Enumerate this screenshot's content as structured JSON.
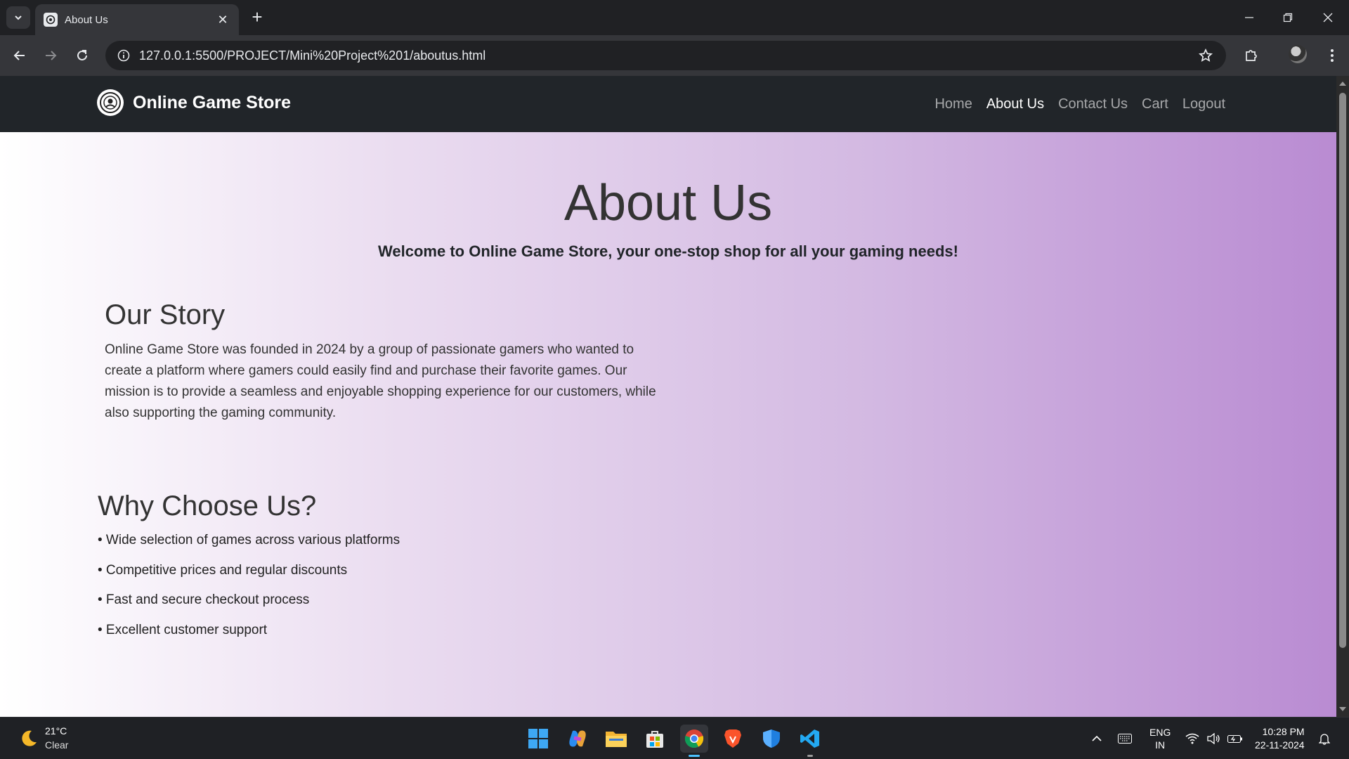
{
  "browser": {
    "tab_title": "About Us",
    "url": "127.0.0.1:5500/PROJECT/Mini%20Project%201/aboutus.html"
  },
  "site": {
    "brand": "Online Game Store",
    "nav": [
      "Home",
      "About Us",
      "Contact Us",
      "Cart",
      "Logout"
    ],
    "active_nav": "About Us"
  },
  "page": {
    "title": "About Us",
    "welcome": "Welcome to Online Game Store, your one-stop shop for all your gaming needs!",
    "story_title": "Our Story",
    "story_text": "Online Game Store was founded in 2024 by a group of passionate gamers who wanted to create a platform where gamers could easily find and purchase their favorite games. Our mission is to provide a seamless and enjoyable shopping experience for our customers, while also supporting the gaming community.",
    "why_title": "Why Choose Us?",
    "why_items": [
      "• Wide selection of games across various platforms",
      "• Competitive prices and regular discounts",
      "• Fast and secure checkout process",
      "• Excellent customer support"
    ]
  },
  "taskbar": {
    "temp": "21°C",
    "condition": "Clear",
    "lang_top": "ENG",
    "lang_bottom": "IN",
    "time": "10:28 PM",
    "date": "22-11-2024"
  },
  "colors": {
    "navbar": "#212529",
    "gradient_start": "#ffffff",
    "gradient_end": "#b98bd2",
    "browser_frame": "#202124"
  }
}
